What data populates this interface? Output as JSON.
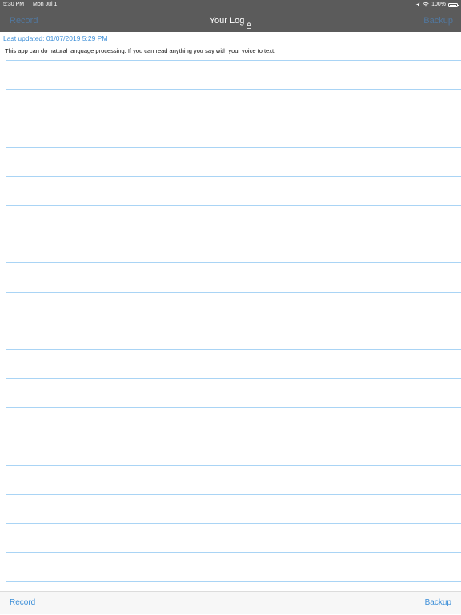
{
  "status_bar": {
    "time": "5:30 PM",
    "date": "Mon Jul 1",
    "battery_percent": "100%",
    "battery_level": 1.0,
    "icons": [
      "location-icon",
      "wifi-icon",
      "battery-icon"
    ]
  },
  "nav": {
    "left_label": "Record",
    "title": "Your Log",
    "title_icon": "lock-icon",
    "right_label": "Backup"
  },
  "log": {
    "last_updated": "Last updated: 01/07/2019 5:29 PM",
    "text": "This app can do natural language processing. If you can read anything you say with your voice to text."
  },
  "toolbar": {
    "left_label": "Record",
    "right_label": "Backup"
  },
  "colors": {
    "bar_background": "#5b5b5b",
    "accent": "#3d8fd8",
    "ruled_line": "#a9d4f5",
    "toolbar_background": "#f7f7f7"
  }
}
